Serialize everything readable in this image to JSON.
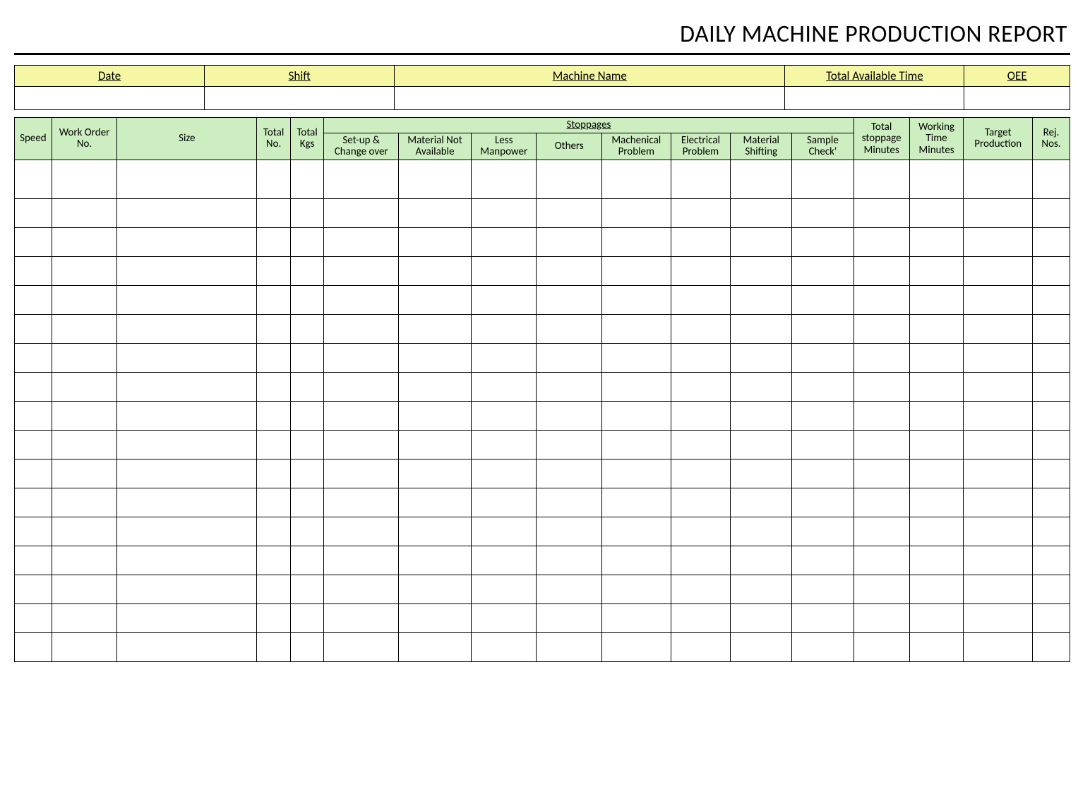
{
  "title": "DAILY MACHINE PRODUCTION REPORT",
  "top": {
    "date_label": "Date",
    "shift_label": "Shift",
    "machine_label": "Machine Name",
    "avail_label": "Total Available Time",
    "oee_label": "OEE",
    "date_value": "",
    "shift_value": "",
    "machine_value": "",
    "avail_value": "",
    "oee_value": ""
  },
  "headers": {
    "speed": "Speed",
    "work_order": "Work Order No.",
    "size": "Size",
    "total_no": "Total No.",
    "total_kgs": "Total Kgs",
    "stoppages": "Stoppages",
    "setup": "Set-up & Change over",
    "material_na": "Material Not Available",
    "less_manpower": "Less Manpower",
    "others": "Others",
    "mech": "Machenical Problem",
    "elec": "Electrical Problem",
    "mat_shift": "Material Shifting",
    "sample": "Sample Check'",
    "total_stop": "Total stoppage Minutes",
    "work_time": "Working Time Minutes",
    "target": "Target Production",
    "rej": "Rej. Nos."
  },
  "row_count": 17
}
